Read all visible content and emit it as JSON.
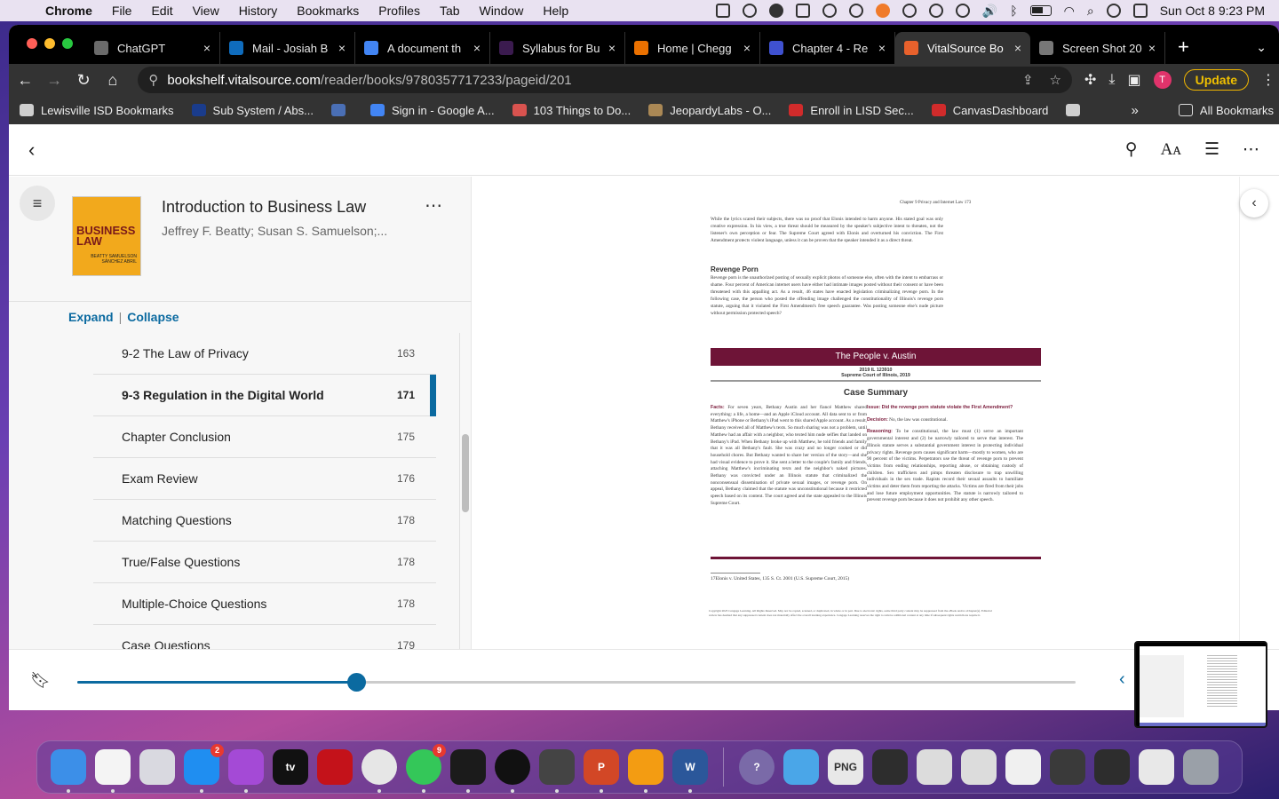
{
  "menubar": {
    "app": "Chrome",
    "items": [
      "File",
      "Edit",
      "View",
      "History",
      "Bookmarks",
      "Profiles",
      "Tab",
      "Window",
      "Help"
    ],
    "clock": "Sun Oct 8  9:23 PM"
  },
  "tabs": [
    {
      "title": "ChatGPT",
      "color": "#6b6b6b"
    },
    {
      "title": "Mail - Josiah B",
      "color": "#0f6cbd"
    },
    {
      "title": "A document th",
      "color": "#4285f4"
    },
    {
      "title": "Syllabus for Bu",
      "color": "#3b1b4f"
    },
    {
      "title": "Home | Chegg",
      "color": "#eb7100"
    },
    {
      "title": "Chapter 4 - Re",
      "color": "#3f51d0"
    },
    {
      "title": "VitalSource Bo",
      "color": "#e8612c"
    },
    {
      "title": "Screen Shot 20",
      "color": "#777777"
    }
  ],
  "address": {
    "host": "bookshelf.vitalsource.com",
    "path": "/reader/books/9780357717233/pageid/201"
  },
  "toolbar": {
    "update_label": "Update",
    "avatar_letter": "T"
  },
  "bookmarks": [
    {
      "label": "Lewisville ISD Bookmarks",
      "color": "#cfcfcf"
    },
    {
      "label": "Sub System / Abs...",
      "color": "#1a3c8c"
    },
    {
      "label": "",
      "color": "#4a6fb5"
    },
    {
      "label": "Sign in - Google A...",
      "color": "#4285f4"
    },
    {
      "label": "103 Things to Do...",
      "color": "#d9534f"
    },
    {
      "label": "JeopardyLabs - O...",
      "color": "#aa8855"
    },
    {
      "label": "Enroll in LISD Sec...",
      "color": "#d12b2b"
    },
    {
      "label": "CanvasDashboard",
      "color": "#d12b2b"
    },
    {
      "label": "",
      "color": "#cfcfcf"
    }
  ],
  "all_bookmarks": "All Bookmarks",
  "book": {
    "title": "Introduction to Business Law",
    "authors": "Jeffrey F. Beatty; Susan S. Samuelson;...",
    "cover_title": "BUSINESS LAW",
    "cover_authors": "BEATTY SAMUELSON SÁNCHEZ ABRIL"
  },
  "sidebar": {
    "expand": "Expand",
    "collapse": "Collapse"
  },
  "toc": [
    {
      "label": "9-2 The Law of Privacy",
      "page": "163"
    },
    {
      "label": "9-3 Regulation in the Digital World",
      "page": "171",
      "current": true
    },
    {
      "label": "Chapter Conclusion",
      "page": "175"
    },
    {
      "label": "Exam Review",
      "page": "176"
    },
    {
      "label": "Matching Questions",
      "page": "178"
    },
    {
      "label": "True/False Questions",
      "page": "178"
    },
    {
      "label": "Multiple-Choice Questions",
      "page": "178"
    },
    {
      "label": "Case Questions",
      "page": "179"
    }
  ],
  "page": {
    "running_head": "Chapter 9     Privacy and Internet Law          173",
    "para1": "While the lyrics scared their subjects, there was no proof that Elonis intended to harm anyone. His stated goal was only creative expression. In his view, a true threat should be measured by the speaker's subjective intent to threaten, not the listener's own perception or fear. The Supreme Court agreed with Elonis and overturned his conviction. The First Amendment protects violent language, unless it can be proven that the speaker intended it as a direct threat.",
    "heading": "Revenge Porn",
    "para2": "Revenge porn is the unauthorized posting of sexually explicit photos of someone else, often with the intent to embarrass or shame. Four percent of American internet users have either had intimate images posted without their consent or have been threatened with this appalling act. As a result, 46 states have enacted legislation criminalizing revenge porn. In the following case, the person who posted the offending image challenged the constitutionality of Illinois's revenge porn statute, arguing that it violated the First Amendment's free speech guarantee. Was posting someone else's nude picture without permission protected speech?",
    "case_title": "The People v. Austin",
    "case_cite1": "2019 IL 123910",
    "case_cite2": "Supreme Court of Illinois, 2019",
    "case_summary": "Case Summary",
    "facts_label": "Facts:",
    "facts": "For seven years, Bethany Austin and her fiancé Matthew shared everything: a life, a home—and an Apple iCloud account. All data sent to or from Matthew's iPhone or Bethany's iPad went to this shared Apple account. As a result, Bethany received all of Matthew's texts. So much sharing was not a problem, until Matthew had an affair with a neighbor, who texted him nude selfies that landed on Bethany's iPad. When Bethany broke up with Matthew, he told friends and family that it was all Bethany's fault. She was crazy and no longer cooked or did household chores. But Bethany wanted to share her version of the story—and she had visual evidence to prove it. She sent a letter to the couple's family and friends, attaching Matthew's incriminating texts and the neighbor's naked pictures. Bethany was convicted under an Illinois statute that criminalized the nonconsensual dissemination of private sexual images, or revenge porn. On appeal, Bethany claimed that the statute was unconstitutional because it restricted speech based on its content. The court agreed and the state appealed to the Illinois Supreme Court.",
    "issue_label": "Issue:",
    "issue": "Did the revenge porn statute violate the First Amendment?",
    "decision_label": "Decision:",
    "decision": "No, the law was constitutional.",
    "reasoning_label": "Reasoning:",
    "reasoning": "To be constitutional, the law must (1) serve an important governmental interest and (2) be narrowly tailored to serve that interest. The Illinois statute serves a substantial government interest in protecting individual privacy rights. Revenge porn causes significant harm—mostly to women, who are 90 percent of the victims. Perpetrators use the threat of revenge porn to prevent victims from ending relationships, reporting abuse, or obtaining custody of children. Sex traffickers and pimps threaten disclosure to trap unwilling individuals in the sex trade. Rapists record their sexual assaults to humiliate victims and deter them from reporting the attacks. Victims are fired from their jobs and lose future employment opportunities. The statute is narrowly tailored to prevent revenge porn because it does not prohibit any other speech.",
    "footnote": "17Elonis v. United States, 135 S. Ct. 2001 (U.S. Supreme Court, 2015)",
    "copyright": "Copyright 2023 Cengage Learning. All Rights Reserved. May not be copied, scanned, or duplicated, in whole or in part. Due to electronic rights, some third party content may be suppressed from the eBook and/or eChapter(s). Editorial review has deemed that any suppressed content does not materially affect the overall learning experience. Cengage Learning reserves the right to remove additional content at any time if subsequent rights restrictions require it."
  },
  "progress": {
    "fraction": 0.279
  },
  "dock": {
    "apps": [
      {
        "name": "finder",
        "color": "#3c8fe8",
        "label": ""
      },
      {
        "name": "slack",
        "color": "#f4f4f4",
        "label": ""
      },
      {
        "name": "launchpad",
        "color": "#d9d9e0",
        "label": ""
      },
      {
        "name": "app-store",
        "color": "#1f8ef1",
        "label": "",
        "badge": "2"
      },
      {
        "name": "podcasts",
        "color": "#a44ad6",
        "label": ""
      },
      {
        "name": "apple-tv",
        "color": "#111111",
        "label": "tv"
      },
      {
        "name": "acrobat",
        "color": "#c4121a",
        "label": ""
      },
      {
        "name": "chrome",
        "color": "#e6e6e6",
        "label": ""
      },
      {
        "name": "messages",
        "color": "#34c759",
        "label": "",
        "badge": "9"
      },
      {
        "name": "webex",
        "color": "#1b1b1b",
        "label": ""
      },
      {
        "name": "spotify",
        "color": "#111111",
        "label": ""
      },
      {
        "name": "keychain",
        "color": "#444444",
        "label": ""
      },
      {
        "name": "powerpoint",
        "color": "#d24726",
        "label": "P"
      },
      {
        "name": "keynote",
        "color": "#f39c12",
        "label": ""
      },
      {
        "name": "word",
        "color": "#2b579a",
        "label": "W"
      },
      {
        "name": "help",
        "color": "#7a6aa8",
        "label": "?"
      },
      {
        "name": "folder",
        "color": "#4aa6e8",
        "label": ""
      },
      {
        "name": "png-file",
        "color": "#e8e8e8",
        "label": "PNG"
      },
      {
        "name": "recent-1",
        "color": "#2d2d2d",
        "label": ""
      },
      {
        "name": "recent-2",
        "color": "#dcdcdc",
        "label": ""
      },
      {
        "name": "recent-3",
        "color": "#dcdcdc",
        "label": ""
      },
      {
        "name": "recent-4",
        "color": "#f0f0f0",
        "label": ""
      },
      {
        "name": "recent-5",
        "color": "#3a3a3a",
        "label": ""
      },
      {
        "name": "recent-6",
        "color": "#2d2d2d",
        "label": ""
      },
      {
        "name": "recent-7",
        "color": "#e8e8e8",
        "label": ""
      },
      {
        "name": "trash",
        "color": "#9aa0a8",
        "label": ""
      }
    ]
  }
}
